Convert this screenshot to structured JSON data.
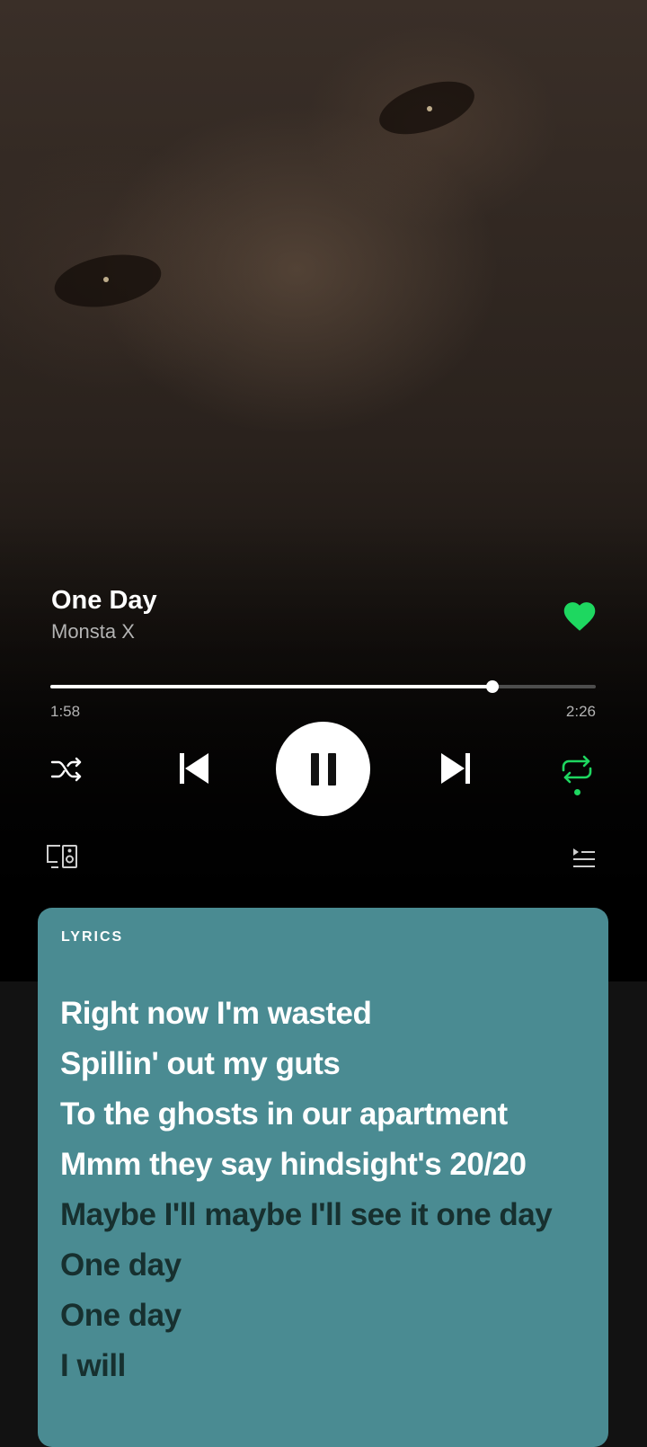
{
  "track": {
    "title": "One Day",
    "artist": "Monsta X",
    "liked": true
  },
  "playback": {
    "elapsed": "1:58",
    "total": "2:26",
    "progress": 0.81,
    "state": "playing",
    "repeat": true
  },
  "controls": {
    "shuffle_icon": "shuffle-icon",
    "previous_icon": "skip-previous-icon",
    "pause_icon": "pause-icon",
    "next_icon": "skip-next-icon",
    "repeat_icon": "repeat-icon",
    "devices_icon": "connect-devices-icon",
    "queue_icon": "queue-icon"
  },
  "lyrics": {
    "heading": "LYRICS",
    "lines": [
      {
        "text": "Right now I'm wasted",
        "state": "past"
      },
      {
        "text": "Spillin' out my guts",
        "state": "past"
      },
      {
        "text": "To the ghosts in our apartment",
        "state": "past"
      },
      {
        "text": "Mmm they say hindsight's 20/20",
        "state": "past"
      },
      {
        "text": "Maybe I'll maybe I'll see it one day",
        "state": "future"
      },
      {
        "text": "One day",
        "state": "future"
      },
      {
        "text": "One day",
        "state": "future"
      },
      {
        "text": "I will",
        "state": "future"
      }
    ]
  },
  "colors": {
    "accent": "#1ed760",
    "lyrics_card": "#4a8b92",
    "lyric_active": "#ffffff",
    "lyric_upcoming": "#17302f",
    "background": "#121212"
  }
}
